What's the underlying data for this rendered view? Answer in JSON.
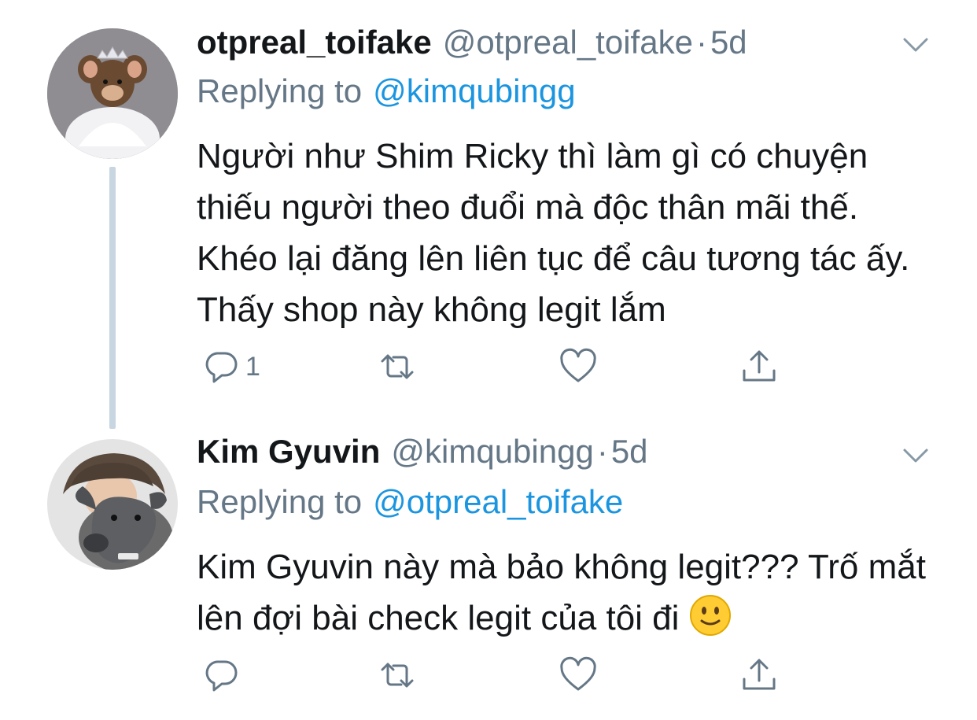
{
  "tweets": [
    {
      "display_name": "otpreal_toifake",
      "handle": "@otpreal_toifake",
      "separator": "·",
      "time": "5d",
      "replying_label": "Replying to",
      "replying_mention": "@kimqubingg",
      "text": "Người như Shim Ricky thì làm gì có chuyện thiếu người theo đuổi mà độc thân mãi thế. Khéo lại đăng lên liên tục để câu tương tác ấy. Thấy shop này không legit lắm",
      "reply_count": "1",
      "avatar_icon": "mouse-princess-avatar"
    },
    {
      "display_name": "Kim Gyuvin",
      "handle": "@kimqubingg",
      "separator": "·",
      "time": "5d",
      "replying_label": "Replying to",
      "replying_mention": "@otpreal_toifake",
      "text": "Kim Gyuvin này mà bảo không legit??? Trố mắt lên đợi bài check legit của tôi đi",
      "emoji": "slightly-smiling-face",
      "avatar_icon": "person-with-dog-avatar"
    }
  ],
  "icons": {
    "reply": "reply-icon",
    "retweet": "retweet-icon",
    "like": "heart-icon",
    "share": "share-icon",
    "more": "chevron-down-icon"
  },
  "colors": {
    "text": "#14171a",
    "secondary": "#657786",
    "link": "#1b95e0",
    "thread_line": "#c8d6e1"
  }
}
